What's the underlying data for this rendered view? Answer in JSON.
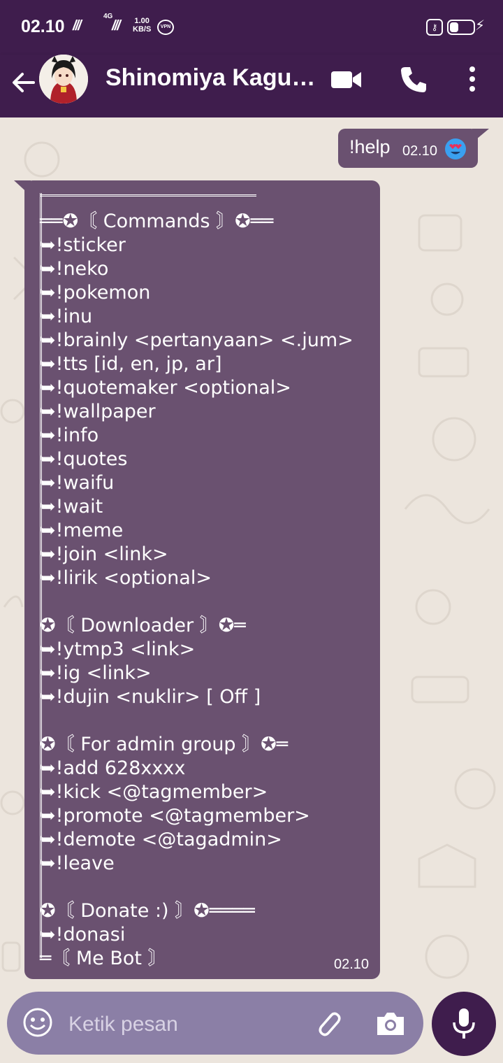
{
  "status_bar": {
    "time": "02.10",
    "network": "4G",
    "speed_value": "1.00",
    "speed_unit": "KB/S",
    "vpn": "VPN"
  },
  "header": {
    "title": "Shinomiya Kagu…",
    "icons": [
      "back-arrow-icon",
      "avatar",
      "video-call-icon",
      "phone-icon",
      "more-vert-icon"
    ]
  },
  "chat": {
    "outgoing": {
      "text": "!help",
      "time": "02.10",
      "emoji": "heart-eyes-emoji"
    },
    "incoming": {
      "time": "02.10",
      "lines": [
        "══✪〘 Commands 〙✪══",
        "➥!sticker",
        "➥!neko",
        "➥!pokemon",
        "➥!inu",
        "➥!brainly <pertanyaan> <.jum>",
        "➥!tts [id, en, jp, ar]",
        "➥!quotemaker <optional>",
        "➥!wallpaper",
        "➥!info",
        "➥!quotes",
        "➥!waifu",
        "➥!wait",
        "➥!meme",
        "➥!join <link>",
        "➥!lirik <optional>",
        "",
        "✪〘 Downloader 〙✪═",
        "➥!ytmp3 <link>",
        "➥!ig <link>",
        "➥!dujin <nuklir> [ Off ]",
        "",
        "✪〘 For admin group 〙✪═",
        "➥!add 628xxxx",
        "➥!kick <@tagmember>",
        "➥!promote <@tagmember>",
        "➥!demote <@tagadmin>",
        "➥!leave",
        "",
        "✪〘 Donate :) 〙✪════",
        "➥!donasi",
        "═〘 Me Bot 〙"
      ]
    }
  },
  "composer": {
    "placeholder": "Ketik pesan",
    "icons": [
      "emoji-icon",
      "attach-icon",
      "camera-icon",
      "mic-icon"
    ]
  },
  "colors": {
    "header": "#3f1d4d",
    "bubble": "#6a5170",
    "input_bar": "#8b7fa6",
    "wallpaper": "#ece5dd"
  }
}
